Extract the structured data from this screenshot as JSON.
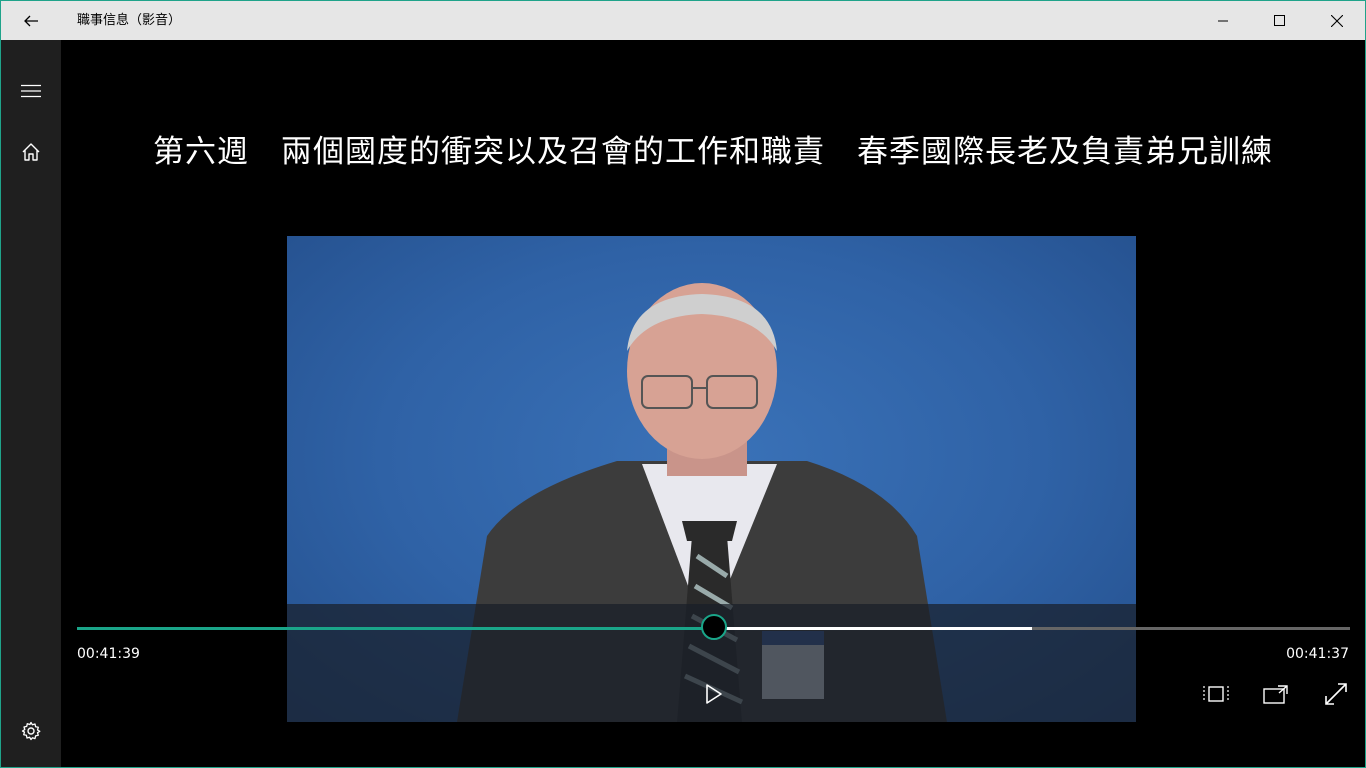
{
  "window": {
    "title": "職事信息（影音）",
    "controls": {
      "minimize": "minimize-icon",
      "maximize": "maximize-icon",
      "close": "close-icon"
    },
    "accent": "#1fa38a"
  },
  "sidenav": {
    "items": [
      {
        "icon": "hamburger-icon"
      },
      {
        "icon": "home-icon"
      }
    ],
    "footer": {
      "icon": "gear-icon"
    }
  },
  "video": {
    "title": "第六週　兩個國度的衝突以及召會的工作和職責　春季國際長老及負責弟兄訓練",
    "background_color": "#2f62a6"
  },
  "player": {
    "elapsed": "00:41:39",
    "remaining": "00:41:37",
    "progress_fraction": 0.5,
    "buffered_fraction": 0.75,
    "accent": "#1aa589",
    "controls": [
      "play-icon",
      "aspect-ratio-icon",
      "cast-to-device-icon",
      "fullscreen-icon"
    ]
  }
}
